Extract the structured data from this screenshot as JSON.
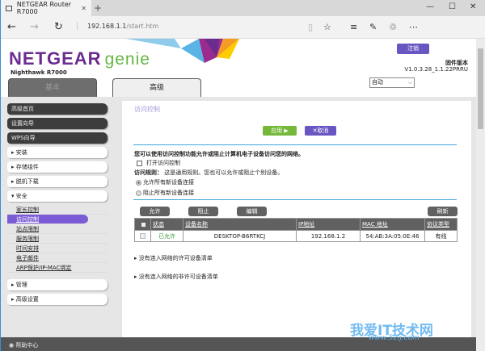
{
  "browser": {
    "tab_title": "NETGEAR Router R7000",
    "url_host": "192.168.1.1",
    "url_path": "/start.htm"
  },
  "header": {
    "brand": "NETGEAR",
    "product": "genie",
    "model": "Nighthawk R7000",
    "logout": "注销",
    "firmware_label": "固件版本",
    "firmware_version": "V1.0.3.28_1.1.22PRRU",
    "language": "自动",
    "tabs": [
      "基本",
      "高级"
    ],
    "active_tab": "高级"
  },
  "sidebar": {
    "top": [
      "高级首页",
      "设置向导",
      "WPS向导"
    ],
    "sections": [
      "安装",
      "存储组件",
      "脱机下载"
    ],
    "security": "安全",
    "security_items": [
      "家长控制",
      "访问控制",
      "站点限制",
      "服务限制",
      "时间安排",
      "电子邮件",
      "ARP保护/IP-MAC绑定"
    ],
    "active_item": "访问控制",
    "bottom": [
      "管理",
      "高级设置"
    ]
  },
  "main": {
    "title": "访问控制",
    "apply": "应用 ▶",
    "cancel": "✕取消",
    "intro": "您可以使用访问控制功能允许或阻止计算机电子设备访问您的网络。",
    "enable_label": "打开访问控制",
    "enable_checked": false,
    "rule_label": "访问规则：",
    "rule_text": "这是通用规则。您也可以允许或阻止个别设备。",
    "radio_allow": "允许所有新设备连接",
    "radio_block": "阻止所有新设备连接",
    "selected_rule": "allow",
    "buttons": {
      "allow": "允许",
      "block": "阻止",
      "edit": "编辑",
      "refresh": "刷新"
    },
    "table": {
      "headers": [
        "状态",
        "设备名称",
        "IP地址",
        "MAC 地址",
        "协议类型"
      ],
      "rows": [
        {
          "status": "已允许",
          "name": "DESKTOP-B6RTKCJ",
          "ip": "192.168.1.2",
          "mac": "54:AB:3A:05:0E:46",
          "type": "有线"
        }
      ]
    },
    "allowed_offline": "没有连入网络的许可设备清单",
    "blocked_offline": "没有连入网络的非许可设备清单"
  },
  "footer": {
    "help": "帮助中心"
  },
  "watermark": {
    "text": "我爱IT技术网",
    "url": "www.52ij.com"
  }
}
